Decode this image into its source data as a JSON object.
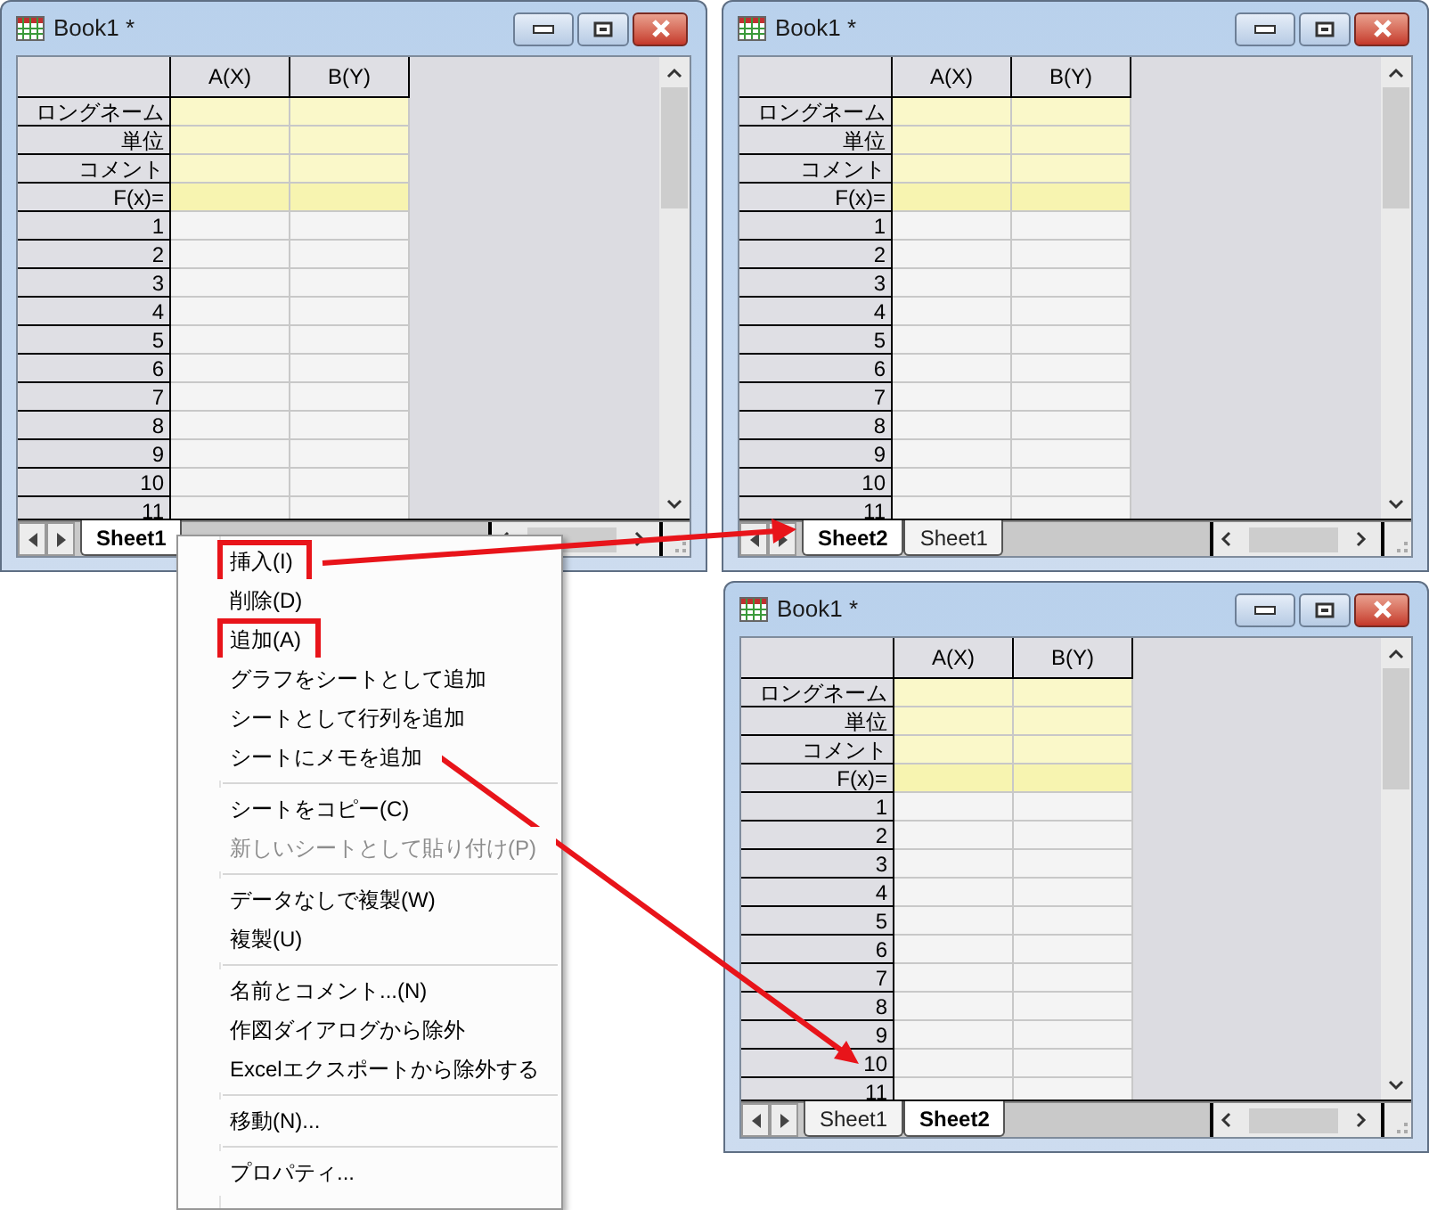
{
  "windows": [
    {
      "title": "Book1 *",
      "columns": [
        "A(X)",
        "B(Y)"
      ],
      "label_rows": [
        "ロングネーム",
        "単位",
        "コメント",
        "F(x)="
      ],
      "rows": [
        "1",
        "2",
        "3",
        "4",
        "5",
        "6",
        "7",
        "8",
        "9",
        "10",
        "11"
      ],
      "tabs": [
        {
          "label": "Sheet1",
          "selected": true
        }
      ]
    },
    {
      "title": "Book1 *",
      "columns": [
        "A(X)",
        "B(Y)"
      ],
      "label_rows": [
        "ロングネーム",
        "単位",
        "コメント",
        "F(x)="
      ],
      "rows": [
        "1",
        "2",
        "3",
        "4",
        "5",
        "6",
        "7",
        "8",
        "9",
        "10",
        "11"
      ],
      "tabs": [
        {
          "label": "Sheet2",
          "selected": true
        },
        {
          "label": "Sheet1",
          "selected": false
        }
      ]
    },
    {
      "title": "Book1 *",
      "columns": [
        "A(X)",
        "B(Y)"
      ],
      "label_rows": [
        "ロングネーム",
        "単位",
        "コメント",
        "F(x)="
      ],
      "rows": [
        "1",
        "2",
        "3",
        "4",
        "5",
        "6",
        "7",
        "8",
        "9",
        "10",
        "11"
      ],
      "tabs": [
        {
          "label": "Sheet1",
          "selected": false
        },
        {
          "label": "Sheet2",
          "selected": true
        }
      ]
    }
  ],
  "context_menu": {
    "items": [
      {
        "kind": "item",
        "label": "挿入(I)",
        "disabled": false,
        "highlighted": true
      },
      {
        "kind": "item",
        "label": "削除(D)",
        "disabled": false,
        "highlighted": false
      },
      {
        "kind": "item",
        "label": "追加(A)",
        "disabled": false,
        "highlighted": true
      },
      {
        "kind": "item",
        "label": "グラフをシートとして追加",
        "disabled": false,
        "highlighted": false
      },
      {
        "kind": "item",
        "label": "シートとして行列を追加",
        "disabled": false,
        "highlighted": false
      },
      {
        "kind": "item",
        "label": "シートにメモを追加",
        "disabled": false,
        "highlighted": false
      },
      {
        "kind": "separator"
      },
      {
        "kind": "item",
        "label": "シートをコピー(C)",
        "disabled": false,
        "highlighted": false
      },
      {
        "kind": "item",
        "label": "新しいシートとして貼り付け(P)",
        "disabled": true,
        "highlighted": false
      },
      {
        "kind": "separator"
      },
      {
        "kind": "item",
        "label": "データなしで複製(W)",
        "disabled": false,
        "highlighted": false
      },
      {
        "kind": "item",
        "label": "複製(U)",
        "disabled": false,
        "highlighted": false
      },
      {
        "kind": "separator"
      },
      {
        "kind": "item",
        "label": "名前とコメント...(N)",
        "disabled": false,
        "highlighted": false
      },
      {
        "kind": "item",
        "label": "作図ダイアログから除外",
        "disabled": false,
        "highlighted": false
      },
      {
        "kind": "item",
        "label": "Excelエクスポートから除外する",
        "disabled": false,
        "highlighted": false
      },
      {
        "kind": "separator"
      },
      {
        "kind": "item",
        "label": "移動(N)...",
        "disabled": false,
        "highlighted": false
      },
      {
        "kind": "separator"
      },
      {
        "kind": "item",
        "label": "プロパティ...",
        "disabled": false,
        "highlighted": false
      }
    ]
  }
}
